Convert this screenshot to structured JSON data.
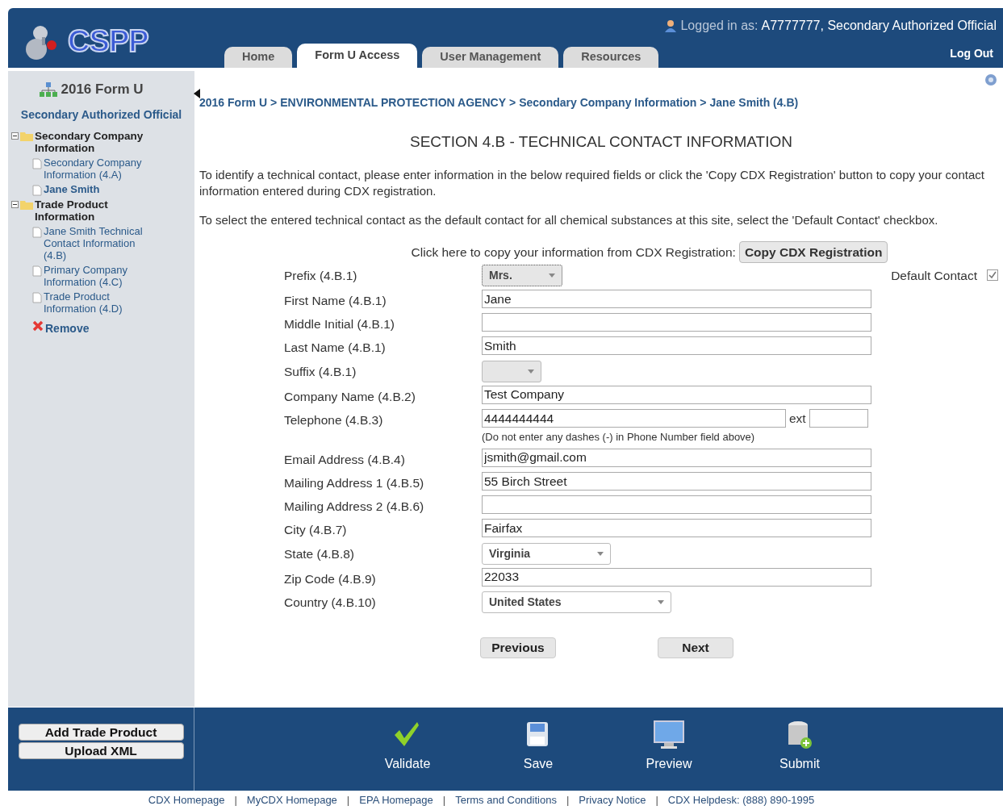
{
  "header": {
    "logo": "CSPP",
    "login_label": "Logged in as:",
    "login_user": "A7777777, Secondary Authorized Official",
    "logout": "Log Out"
  },
  "tabs": [
    {
      "label": "Home",
      "selected": false
    },
    {
      "label": "Form U Access",
      "selected": true
    },
    {
      "label": "User Management",
      "selected": false
    },
    {
      "label": "Resources",
      "selected": false
    }
  ],
  "sidebar": {
    "title": "2016 Form U",
    "subtitle": "Secondary Authorized Official",
    "tree": [
      {
        "kind": "folder",
        "label": "Secondary Company Information",
        "expanded": true,
        "children": [
          {
            "kind": "page",
            "label": "Secondary Company Information (4.A)",
            "selected": false
          },
          {
            "kind": "page",
            "label": "Jane Smith",
            "selected": true
          }
        ]
      },
      {
        "kind": "folder",
        "label": "Trade Product Information",
        "expanded": true,
        "children": [
          {
            "kind": "page",
            "label": "Jane Smith Technical Contact Information (4.B)",
            "selected": false
          },
          {
            "kind": "page",
            "label": "Primary Company Information (4.C)",
            "selected": false
          },
          {
            "kind": "page",
            "label": "Trade Product Information (4.D)",
            "selected": false
          },
          {
            "kind": "remove",
            "label": "Remove",
            "selected": false
          }
        ]
      }
    ],
    "buttons": [
      "Add Trade Product",
      "Upload XML"
    ]
  },
  "breadcrumb": [
    {
      "text": "2016 Form U",
      "separator": ">"
    },
    {
      "text": "ENVIRONMENTAL PROTECTION AGENCY",
      "separator": ">"
    },
    {
      "text": "Secondary Company Information",
      "separator": ">"
    },
    {
      "text": "Jane Smith (4.B)"
    }
  ],
  "section_title": "SECTION 4.B - TECHNICAL CONTACT INFORMATION",
  "instructions": [
    "To identify a technical contact, please enter information in the below required fields or click the 'Copy CDX Registration' button to copy your contact information entered during CDX registration.",
    "To select the entered technical contact as the default contact for all chemical substances at this site, select the 'Default Contact' checkbox."
  ],
  "copy_prompt": "Click here to copy your information from CDX Registration:",
  "copy_button": "Copy CDX Registration",
  "default_contact": {
    "label": "Default Contact",
    "checked": true
  },
  "fields": [
    {
      "kind": "select",
      "label": "Prefix (4.B.1)",
      "value": "Mrs.",
      "focused": true
    },
    {
      "kind": "text",
      "label": "First Name (4.B.1)",
      "value": "Jane"
    },
    {
      "kind": "text",
      "label": "Middle Initial (4.B.1)"
    },
    {
      "kind": "text",
      "label": "Last Name (4.B.1)",
      "value": "Smith"
    },
    {
      "kind": "select",
      "label": "Suffix (4.B.1)",
      "focused": false
    },
    {
      "kind": "text",
      "label": "Company Name (4.B.2)",
      "value": "Test Company"
    },
    {
      "kind": "phone",
      "label": "Telephone (4.B.3)",
      "value": "4444444444",
      "ext_label": "ext",
      "hint": "(Do not enter any dashes (-) in Phone Number field above)"
    },
    {
      "kind": "text",
      "label": "Email Address (4.B.4)",
      "value": "jsmith@gmail.com"
    },
    {
      "kind": "text",
      "label": "Mailing Address 1 (4.B.5)",
      "value": "55 Birch Street"
    },
    {
      "kind": "text",
      "label": "Mailing Address 2 (4.B.6)"
    },
    {
      "kind": "text",
      "label": "City (4.B.7)",
      "value": "Fairfax"
    },
    {
      "kind": "select",
      "label": "State (4.B.8)",
      "value": "Virginia",
      "focused": false
    },
    {
      "kind": "text",
      "label": "Zip Code (4.B.9)",
      "value": "22033"
    },
    {
      "kind": "select",
      "label": "Country (4.B.10)",
      "value": "United States",
      "focused": false
    }
  ],
  "nav_buttons": [
    "Previous",
    "Next"
  ],
  "actions": [
    {
      "kind": "validate",
      "label": "Validate"
    },
    {
      "kind": "save",
      "label": "Save"
    },
    {
      "kind": "preview",
      "label": "Preview"
    },
    {
      "kind": "submit",
      "label": "Submit"
    }
  ],
  "footer_links": [
    {
      "kind": "link",
      "text": "CDX Homepage"
    },
    {
      "kind": "separator",
      "text": "|"
    },
    {
      "kind": "link",
      "text": "MyCDX Homepage"
    },
    {
      "kind": "separator",
      "text": "|"
    },
    {
      "kind": "link",
      "text": "EPA Homepage"
    },
    {
      "kind": "separator",
      "text": "|"
    },
    {
      "kind": "link",
      "text": "Terms and Conditions"
    },
    {
      "kind": "separator",
      "text": "|"
    },
    {
      "kind": "link",
      "text": "Privacy Notice"
    },
    {
      "kind": "separator",
      "text": "|"
    },
    {
      "kind": "link",
      "text": "CDX Helpdesk: (888) 890-1995"
    }
  ]
}
